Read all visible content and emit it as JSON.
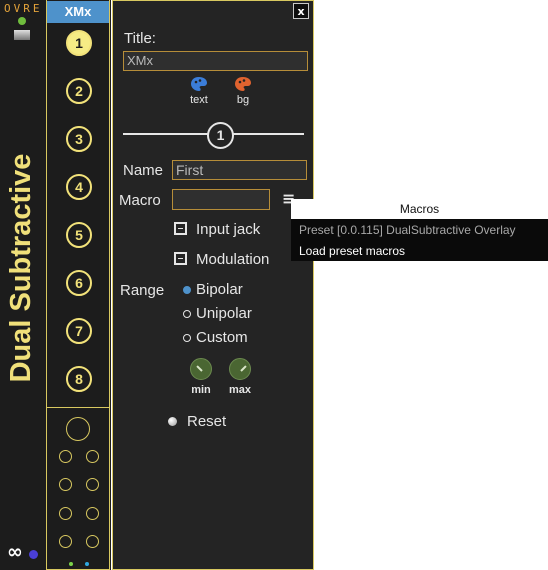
{
  "strip": {
    "logo_text": "OVRE",
    "vertical_title": "Dual Subtractive",
    "infinity_symbol": "∞"
  },
  "tab": {
    "label": "XMx"
  },
  "numbers": [
    "1",
    "2",
    "3",
    "4",
    "5",
    "6",
    "7",
    "8"
  ],
  "active_number": "1",
  "panel": {
    "close_label": "x",
    "title_label": "Title:",
    "title_value": "XMx",
    "text_color_caption": "text",
    "bg_color_caption": "bg",
    "slider_number": "1",
    "name_label": "Name",
    "name_value": "First",
    "macro_label": "Macro",
    "macro_value": "",
    "menu_icon": "≡",
    "input_jack_label": "Input jack",
    "modulation_label": "Modulation",
    "range_label": "Range",
    "range_options": [
      "Bipolar",
      "Unipolar",
      "Custom"
    ],
    "range_selected": "Bipolar",
    "min_label": "min",
    "max_label": "max",
    "reset_label": "Reset"
  },
  "dropdown": {
    "header": "Macros",
    "items": [
      "Preset [0.0.115] DualSubtractive Overlay",
      "Load preset macros"
    ]
  },
  "colors": {
    "accent_yellow": "#f2e27a",
    "accent_blue": "#4e92cb",
    "text_swatch": "#3b7dd8",
    "bg_swatch": "#e0632f",
    "field_border": "#b68d39"
  }
}
